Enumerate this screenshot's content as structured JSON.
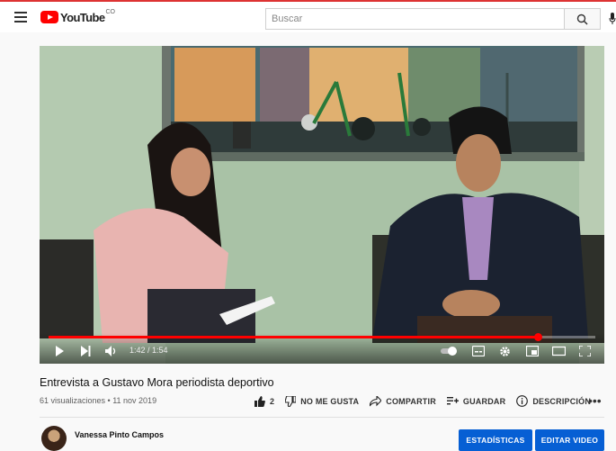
{
  "header": {
    "logo_text": "YouTube",
    "logo_sup": "CO",
    "search_placeholder": "Buscar"
  },
  "player": {
    "time_current": "1:42",
    "time_total": "1:54",
    "time_label": "1:42 / 1:54",
    "progress": 0.895
  },
  "video": {
    "title": "Entrevista a Gustavo Mora periodista deportivo",
    "meta": "61 visualizaciones • 11 nov 2019"
  },
  "actions": {
    "like_count": "2",
    "dislike_label": "NO ME GUSTA",
    "share_label": "COMPARTIR",
    "save_label": "GUARDAR",
    "description_label": "DESCRIPCIÓN",
    "more_label": "•••"
  },
  "channel": {
    "name": "Vanessa Pinto Campos",
    "stats_button": "ESTADÍSTICAS",
    "edit_button": "EDITAR VIDEO"
  },
  "colors": {
    "brand_red": "#ff0000",
    "button_blue": "#065fd4"
  }
}
